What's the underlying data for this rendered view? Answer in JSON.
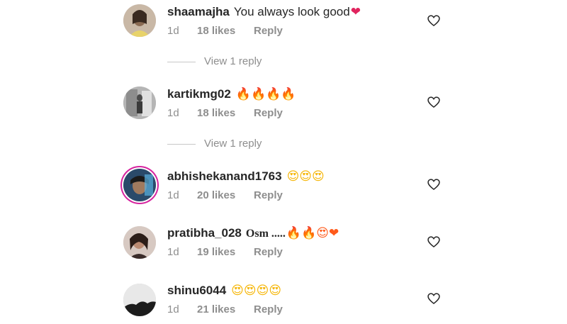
{
  "comments": [
    {
      "username": "shaamajha",
      "text": "You always look good",
      "emoji": "❤",
      "time": "1d",
      "likes": "18 likes",
      "reply": "Reply",
      "view_replies": "View 1 reply"
    },
    {
      "username": "kartikmg02",
      "text": "",
      "emoji": "🔥🔥🔥🔥",
      "time": "1d",
      "likes": "18 likes",
      "reply": "Reply",
      "view_replies": "View 1 reply"
    },
    {
      "username": "abhishekanand1763",
      "text": "",
      "emoji": "😍😍😍",
      "time": "1d",
      "likes": "20 likes",
      "reply": "Reply"
    },
    {
      "username": "pratibha_028",
      "text": "Osm .....",
      "emoji": "🔥🔥😍❤",
      "time": "1d",
      "likes": "19 likes",
      "reply": "Reply"
    },
    {
      "username": "shinu6044",
      "text": "",
      "emoji": "😍😍😍😍",
      "time": "1d",
      "likes": "21 likes",
      "reply": "Reply"
    }
  ],
  "colors": {
    "text": "#262626",
    "meta": "#8e8e8e",
    "story_ring": "#d6249f"
  },
  "icons": {
    "like": "heart-outline-icon"
  }
}
